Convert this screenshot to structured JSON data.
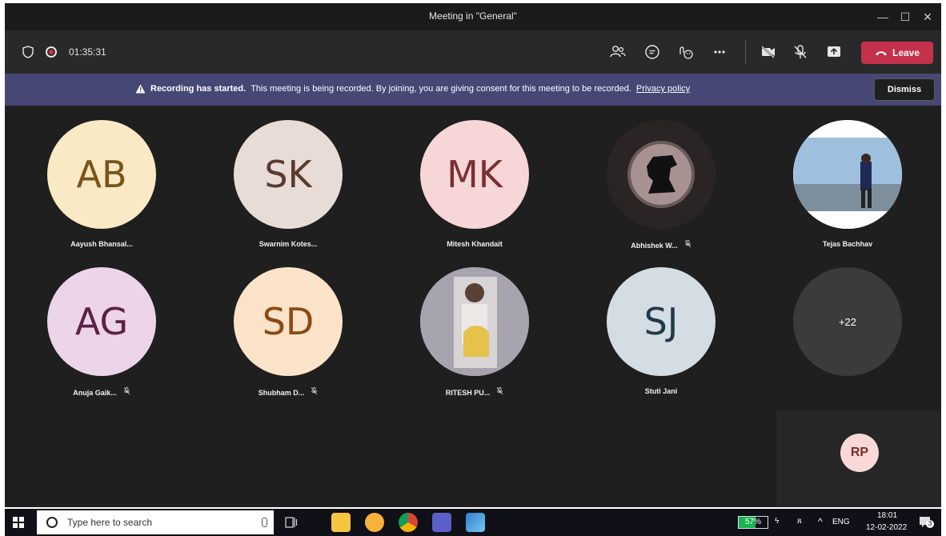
{
  "window": {
    "title": "Meeting in \"General\"",
    "minimize": "—",
    "maximize": "☐",
    "close": "✕"
  },
  "toolbar": {
    "timer": "01:35:31",
    "leave_label": "Leave"
  },
  "banner": {
    "bold_text": "Recording has started.",
    "text": "This meeting is being recorded. By joining, you are giving consent for this meeting to be recorded.",
    "link_text": "Privacy policy",
    "dismiss_label": "Dismiss"
  },
  "participants": [
    {
      "initials": "AB",
      "name": "Aayush Bhansal...",
      "bg": "#f9e9c4",
      "fg": "#7a5418",
      "muted": false
    },
    {
      "initials": "SK",
      "name": "Swarnim Kotes...",
      "bg": "#e8dcd6",
      "fg": "#5c3a2e",
      "muted": false
    },
    {
      "initials": "MK",
      "name": "Mitesh Khandait",
      "bg": "#f6d6d6",
      "fg": "#7a2f33",
      "muted": false
    },
    {
      "initials": "",
      "name": "Abhishek W...",
      "bg": "#3a3535",
      "fg": "#ffffff",
      "muted": true,
      "image": "detective-silhouette"
    },
    {
      "initials": "",
      "name": "Tejas Bachhav",
      "bg": "#ffffff",
      "fg": "#ffffff",
      "muted": false,
      "image": "lakeside-photo"
    },
    {
      "initials": "AG",
      "name": "Anuja Gaik...",
      "bg": "#ecd5e8",
      "fg": "#5e2146",
      "muted": true
    },
    {
      "initials": "SD",
      "name": "Shubham D...",
      "bg": "#fbe3c9",
      "fg": "#8a4a16",
      "muted": true
    },
    {
      "initials": "",
      "name": "RITESH PU...",
      "bg": "#a7a4b0",
      "fg": "#ffffff",
      "muted": true,
      "image": "selfie-photo"
    },
    {
      "initials": "SJ",
      "name": "Stuti Jani",
      "bg": "#d4dde3",
      "fg": "#1f3a4a",
      "muted": false
    },
    {
      "initials": "+22",
      "name": "",
      "bg": "#3b3b3b",
      "fg": "#ffffff",
      "muted": false
    }
  ],
  "self_view": {
    "initials": "RP"
  },
  "taskbar": {
    "search_placeholder": "Type here to search",
    "battery": "57%",
    "battery_level": 0.57,
    "language": "ENG",
    "time": "18:01",
    "date": "12-02-2022",
    "notifications": "3"
  }
}
